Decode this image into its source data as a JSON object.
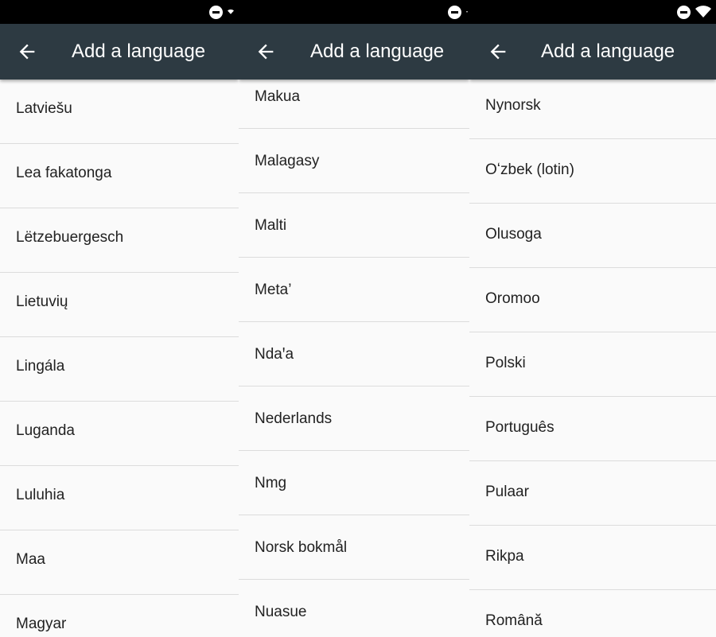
{
  "panels": [
    {
      "title": "Add a language",
      "languages": [
        "Latviešu",
        "Lea fakatonga",
        "Lëtzebuergesch",
        "Lietuvių",
        "Lingála",
        "Luganda",
        "Luluhia",
        "Maa",
        "Magyar"
      ]
    },
    {
      "title": "Add a language",
      "languages": [
        "Makua",
        "Malagasy",
        "Malti",
        "Meta’",
        "Ndaꞌa",
        "Nederlands",
        "Nmg",
        "Norsk bokmål",
        "Nuasue"
      ]
    },
    {
      "title": "Add a language",
      "languages": [
        "Nynorsk",
        "Oʻzbek (lotin)",
        "Olusoga",
        "Oromoo",
        "Polski",
        "Português",
        "Pulaar",
        "Rikpa",
        "Română"
      ]
    }
  ],
  "colors": {
    "app_bar": "#2d3a42",
    "status_bar": "#000000",
    "background": "#fafafa",
    "divider": "#dcdcdc"
  },
  "icons": {
    "back": "arrow-back-icon",
    "status": [
      "do-not-disturb-icon",
      "wifi-icon"
    ]
  }
}
